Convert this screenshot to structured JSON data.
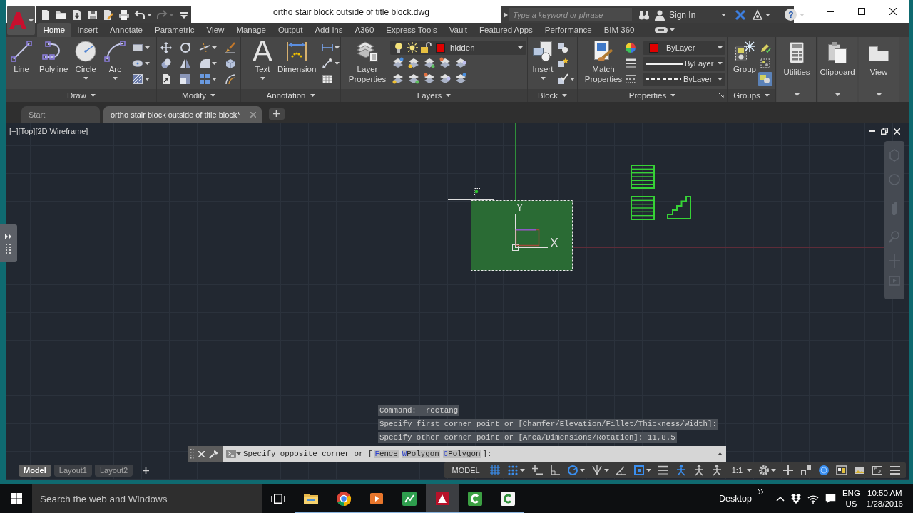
{
  "quick_access": [
    {
      "kind": "new",
      "disabled": false
    },
    {
      "kind": "open",
      "disabled": false
    },
    {
      "kind": "save_as",
      "disabled": false
    },
    {
      "kind": "save",
      "disabled": false
    },
    {
      "kind": "web",
      "disabled": false
    },
    {
      "kind": "plot",
      "disabled": false
    },
    {
      "kind": "undo",
      "disabled": false
    },
    {
      "kind": "redo",
      "disabled": true
    },
    {
      "kind": "customize",
      "disabled": false
    }
  ],
  "window": {
    "title": "ortho stair block outside of title block.dwg"
  },
  "search": {
    "placeholder": "Type a keyword or phrase"
  },
  "account": {
    "label": "Sign In"
  },
  "help": {
    "glyph": "?"
  },
  "ribbon": {
    "tabs": [
      {
        "label": "Home",
        "selected": true
      },
      {
        "label": "Insert",
        "selected": false
      },
      {
        "label": "Annotate",
        "selected": false
      },
      {
        "label": "Parametric",
        "selected": false
      },
      {
        "label": "View",
        "selected": false
      },
      {
        "label": "Manage",
        "selected": false
      },
      {
        "label": "Output",
        "selected": false
      },
      {
        "label": "Add-ins",
        "selected": false
      },
      {
        "label": "A360",
        "selected": false
      },
      {
        "label": "Express Tools",
        "selected": false
      },
      {
        "label": "Vault",
        "selected": false
      },
      {
        "label": "Featured Apps",
        "selected": false
      },
      {
        "label": "Performance",
        "selected": false
      },
      {
        "label": "BIM 360",
        "selected": false
      }
    ],
    "panels": [
      {
        "kind": "draw",
        "title": "Draw",
        "tools": [
          {
            "label": "Line",
            "menu": false
          },
          {
            "label": "Polyline",
            "menu": false
          },
          {
            "label": "Circle",
            "menu": true
          },
          {
            "label": "Arc",
            "menu": true
          }
        ]
      },
      {
        "kind": "modify",
        "title": "Modify"
      },
      {
        "kind": "annotation",
        "title": "Annotation",
        "tools": [
          {
            "label": "Text",
            "glyph": "A",
            "menu": true
          },
          {
            "label": "Dimension",
            "menu": false
          }
        ]
      },
      {
        "kind": "layers",
        "title": "Layers",
        "tools": [
          {
            "label": "Layer Properties",
            "menu": false
          }
        ],
        "layer": {
          "name": "hidden",
          "color": "#e00000"
        }
      },
      {
        "kind": "block",
        "title": "Block",
        "tools": [
          {
            "label": "Insert",
            "menu": true
          }
        ]
      },
      {
        "kind": "properties",
        "title": "Properties",
        "launcher": true,
        "tools": [
          {
            "label": "Match Properties",
            "menu": false
          }
        ],
        "dropdowns": [
          {
            "kind": "color",
            "value": "ByLayer",
            "color": "#e00000"
          },
          {
            "kind": "lineweight",
            "value": "ByLayer"
          },
          {
            "kind": "linetype",
            "value": "ByLayer"
          }
        ]
      },
      {
        "kind": "groups",
        "title": "Groups",
        "tools": [
          {
            "label": "Group",
            "menu": false
          }
        ],
        "selection_toggle_on": true
      },
      {
        "kind": "utilities",
        "title": "Utilities"
      },
      {
        "kind": "clipboard",
        "title": "Clipboard"
      },
      {
        "kind": "view",
        "title": "View"
      }
    ]
  },
  "file_tabs": [
    {
      "label": "Start",
      "selected": false,
      "closable": false
    },
    {
      "label": "ortho stair block outside of title block*",
      "selected": true,
      "closable": true
    }
  ],
  "viewport": {
    "label": "[−][Top][2D Wireframe]",
    "ucs": {
      "x_label": "X",
      "y_label": "Y"
    }
  },
  "command_line": {
    "history": [
      "Command: _rectang",
      "Specify first corner point or [Chamfer/Elevation/Fillet/Thickness/Width]:",
      "Specify other corner point or [Area/Dimensions/Rotation]: 11,8.5"
    ],
    "prompt": {
      "text": "Specify opposite corner or [",
      "options": [
        "Fence",
        "WPolygon",
        "CPolygon"
      ],
      "end": "]:"
    }
  },
  "layout_tabs": [
    {
      "label": "Model",
      "selected": true
    },
    {
      "label": "Layout1",
      "selected": false
    },
    {
      "label": "Layout2",
      "selected": false
    }
  ],
  "status_bar": {
    "items": [
      {
        "kind": "mode",
        "label": "MODEL",
        "on": false
      },
      {
        "kind": "grid",
        "on": true
      },
      {
        "kind": "snap",
        "on": true
      },
      {
        "kind": "infer",
        "on": false
      },
      {
        "kind": "ortho",
        "on": false
      },
      {
        "kind": "polar",
        "on": true
      },
      {
        "kind": "isodraft",
        "on": false
      },
      {
        "kind": "tracking",
        "on": false
      },
      {
        "kind": "osnap",
        "on": true
      },
      {
        "kind": "lineweight",
        "on": false
      },
      {
        "kind": "annovis",
        "on": true
      },
      {
        "kind": "autoscale",
        "on": false
      },
      {
        "kind": "annoscale",
        "on": false
      },
      {
        "kind": "scale",
        "label": "1:1",
        "on": false
      },
      {
        "kind": "workspace",
        "on": false
      },
      {
        "kind": "monitor",
        "on": false
      },
      {
        "kind": "isolate",
        "on": false
      },
      {
        "kind": "hardware",
        "on": true
      },
      {
        "kind": "panes",
        "on": false
      },
      {
        "kind": "image",
        "on": false
      },
      {
        "kind": "fullscreen",
        "on": false
      },
      {
        "kind": "customize",
        "on": false
      }
    ]
  },
  "taskbar": {
    "search": {
      "placeholder": "Search the web and Windows"
    },
    "apps": [
      {
        "kind": "explorer",
        "active": false,
        "running": true
      },
      {
        "kind": "browser",
        "active": false,
        "running": true
      },
      {
        "kind": "media",
        "active": false,
        "running": true
      },
      {
        "kind": "green_app",
        "active": false,
        "running": true
      },
      {
        "kind": "autocad",
        "active": true,
        "running": true
      },
      {
        "kind": "camtasia",
        "active": false,
        "running": true
      },
      {
        "kind": "recorder",
        "active": false,
        "running": true
      }
    ],
    "desktop": "Desktop",
    "language": {
      "input": "ENG",
      "region": "US"
    },
    "time": "10:50 AM",
    "date": "1/28/2016"
  }
}
